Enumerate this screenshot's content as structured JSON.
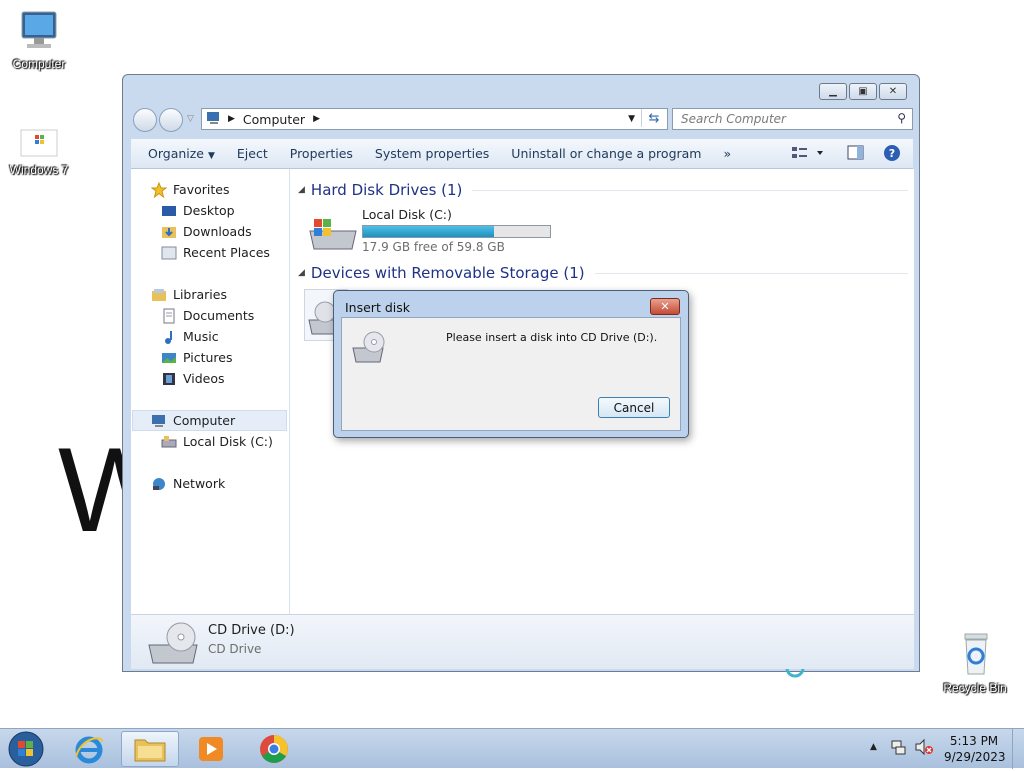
{
  "desktop": {
    "icons": [
      {
        "label": "Computer"
      },
      {
        "label": "Windows 7"
      },
      {
        "label": "Recycle Bin"
      }
    ]
  },
  "address": {
    "segment": "Computer",
    "search_placeholder": "Search Computer"
  },
  "toolbar": {
    "organize": "Organize",
    "eject": "Eject",
    "properties": "Properties",
    "system_properties": "System properties",
    "uninstall": "Uninstall or change a program",
    "more": "»"
  },
  "navpane": {
    "favorites": "Favorites",
    "desktop": "Desktop",
    "downloads": "Downloads",
    "recent": "Recent Places",
    "libraries": "Libraries",
    "documents": "Documents",
    "music": "Music",
    "pictures": "Pictures",
    "videos": "Videos",
    "computer": "Computer",
    "local_disk": "Local Disk (C:)",
    "network": "Network"
  },
  "content": {
    "hdd_group": "Hard Disk Drives (1)",
    "drive_name": "Local Disk (C:)",
    "drive_space": "17.9 GB free of 59.8 GB",
    "drive_used_fraction": 0.7,
    "removable_group": "Devices with Removable Storage (1)"
  },
  "details": {
    "name": "CD Drive (D:)",
    "type": "CD Drive"
  },
  "dialog": {
    "title": "Insert disk",
    "message": "Please insert a disk into CD Drive (D:).",
    "cancel": "Cancel"
  },
  "clock": {
    "time": "5:13 PM",
    "date": "9/29/2023"
  },
  "colors": {
    "progress_fill": "#2aa7d6",
    "group_header": "#1e3287"
  }
}
